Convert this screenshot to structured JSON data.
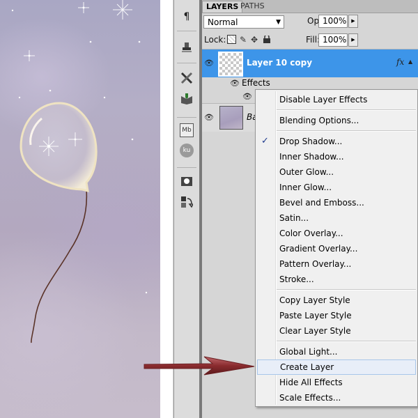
{
  "panel": {
    "tabs": [
      {
        "label": "LAYERS"
      },
      {
        "label": "PATHS"
      }
    ],
    "blend_mode": "Normal",
    "opacity_label": "Opacity:",
    "opacity_value": "100%",
    "lock_label": "Lock:",
    "fill_label": "Fill:",
    "fill_value": "100%",
    "layers": [
      {
        "name": "Layer 10 copy",
        "selected": true,
        "fx": "fx",
        "effects_label": "Effects"
      },
      {
        "name": "Ba",
        "selected": false
      }
    ]
  },
  "toolbar": {
    "icons": [
      "paragraph-icon",
      "stamp-icon",
      "tools-icon",
      "book-icon",
      "mb-icon",
      "ku-icon",
      "camera-icon",
      "swap-icon"
    ],
    "mb_label": "Mb",
    "ku_label": "ku"
  },
  "context_menu": {
    "items": [
      {
        "label": "Disable Layer Effects"
      },
      {
        "label": "Blending Options..."
      },
      {
        "label": "Drop Shadow...",
        "checked": true
      },
      {
        "label": "Inner Shadow..."
      },
      {
        "label": "Outer Glow..."
      },
      {
        "label": "Inner Glow..."
      },
      {
        "label": "Bevel and Emboss..."
      },
      {
        "label": "Satin..."
      },
      {
        "label": "Color Overlay..."
      },
      {
        "label": "Gradient Overlay..."
      },
      {
        "label": "Pattern Overlay..."
      },
      {
        "label": "Stroke..."
      },
      {
        "label": "Copy Layer Style"
      },
      {
        "label": "Paste Layer Style"
      },
      {
        "label": "Clear Layer Style"
      },
      {
        "label": "Global Light..."
      },
      {
        "label": "Create Layer",
        "highlighted": true
      },
      {
        "label": "Hide All Effects"
      },
      {
        "label": "Scale Effects..."
      }
    ]
  },
  "colors": {
    "selection_blue": "#3d95e9",
    "arrow_red": "#8a2b2e"
  }
}
